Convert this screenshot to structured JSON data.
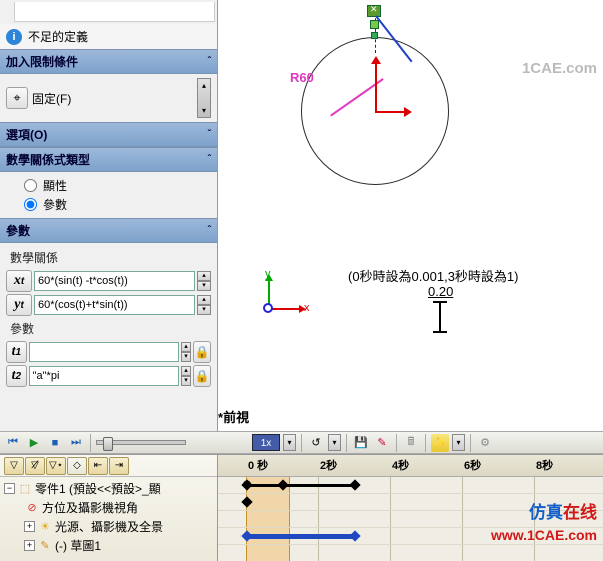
{
  "info_text": "不足的定義",
  "sections": {
    "constraints_title": "加入限制條件",
    "fixed_label": "固定(F)",
    "options_title": "選項(O)",
    "eqtype_title": "數學關係式類型",
    "radio_explicit": "顯性",
    "radio_param": "參數",
    "params_title": "參數",
    "mathrel_label": "數學關係",
    "param_sub_label": "參數"
  },
  "vars": {
    "xt": "60*(sin(t) -t*cos(t))",
    "yt": "60*(cos(t)+t*sin(t))",
    "t1": "",
    "t2": "\"a\"*pi"
  },
  "canvas": {
    "radius_label": "R60",
    "note": "(0秒時設為0.001,3秒時設為1)",
    "dim": "0.20",
    "triad_x": "x",
    "triad_y": "y",
    "view_label": "前視"
  },
  "timeline_bar": {
    "speed": "1x"
  },
  "timeline": {
    "ticks": [
      "0 秒",
      "2秒",
      "4秒",
      "6秒",
      "8秒"
    ],
    "tree": {
      "root": "零件1 (預設<<預設>_顯",
      "row1": "方位及攝影機視角",
      "row2": "光源、攝影機及全景",
      "row3": "(-) 草圖1"
    }
  },
  "watermarks": {
    "w1": "1CAE.com",
    "w2a": "仿真",
    "w2b": "在线",
    "w3": "www.1CAE.com"
  }
}
